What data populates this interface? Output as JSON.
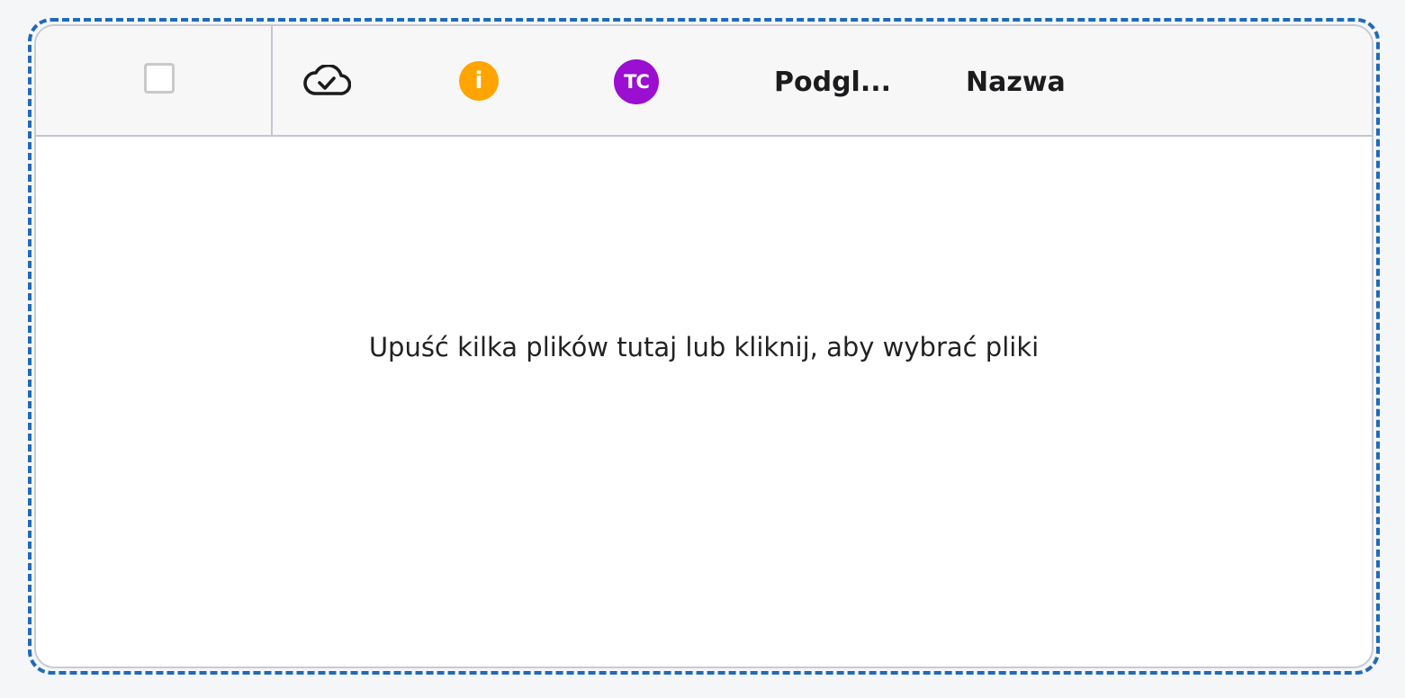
{
  "header": {
    "select_all_checked": false,
    "sync_icon": "cloud-check-icon",
    "info_badge": "i",
    "tc_badge": "TC",
    "preview_column": "Podgl...",
    "name_column": "Nazwa"
  },
  "dropzone": {
    "empty_message": "Upuść kilka plików tutaj lub kliknij, aby wybrać pliki"
  },
  "colors": {
    "dropzone_border": "#1f6bb8",
    "info_badge": "#ffa400",
    "tc_badge": "#9a0fd0"
  }
}
